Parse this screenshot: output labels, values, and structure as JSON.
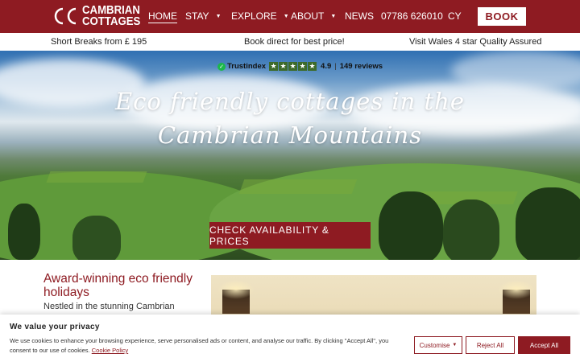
{
  "header": {
    "logo_initials": "CC",
    "logo_line1": "CAMBRIAN",
    "logo_line2": "COTTAGES",
    "nav": {
      "home": "HOME",
      "stay": "STAY",
      "explore": "EXPLORE",
      "about": "ABOUT",
      "news": "NEWS",
      "phone": "07786 626010",
      "lang": "CY"
    },
    "book_label": "BOOK"
  },
  "infobar": {
    "left": "Short Breaks from £ 195",
    "center": "Book direct for best price!",
    "right": "Visit Wales 4 star Quality Assured"
  },
  "hero": {
    "trust_brand": "Trustindex",
    "trust_score": "4.9",
    "trust_sep": "|",
    "trust_reviews": "149 reviews",
    "title_line1": "Eco friendly cottages in the",
    "title_line2": "Cambrian Mountains",
    "cta_label": "CHECK AVAILABILITY & PRICES"
  },
  "intro": {
    "title": "Award-winning eco friendly holidays",
    "text": "Nestled in the stunning Cambrian"
  },
  "cookie": {
    "title": "We value your privacy",
    "text": "We use cookies to enhance your browsing experience, serve personalised ads or content, and analyse our traffic. By clicking \"Accept All\", you consent to our use of cookies.",
    "link": "Cookie Policy",
    "customise": "Customise",
    "reject": "Reject All",
    "accept": "Accept All"
  },
  "colors": {
    "brand": "#8e1b22",
    "trust_green": "#1bb84a"
  }
}
